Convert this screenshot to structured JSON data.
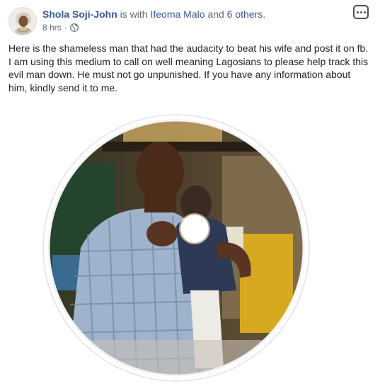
{
  "post": {
    "author": "Shola Soji-John",
    "with_text": "is with",
    "tagged_person": "Ifeoma Malo",
    "and_text": "and",
    "others_text": "6 others.",
    "timestamp": "8 hrs",
    "separator": "·",
    "privacy_icon": "globe-icon",
    "more_icon": "more-options-icon",
    "body": "Here is the shameless man that had the audacity to beat his wife and post it on fb. I am using this medium to call on well meaning Lagosians to please help track this evil man down. He must not go unpunished. If you have any information about him, kindly send it to me."
  },
  "colors": {
    "link": "#385898",
    "text": "#1d2129",
    "meta": "#616770",
    "background": "#ffffff"
  }
}
